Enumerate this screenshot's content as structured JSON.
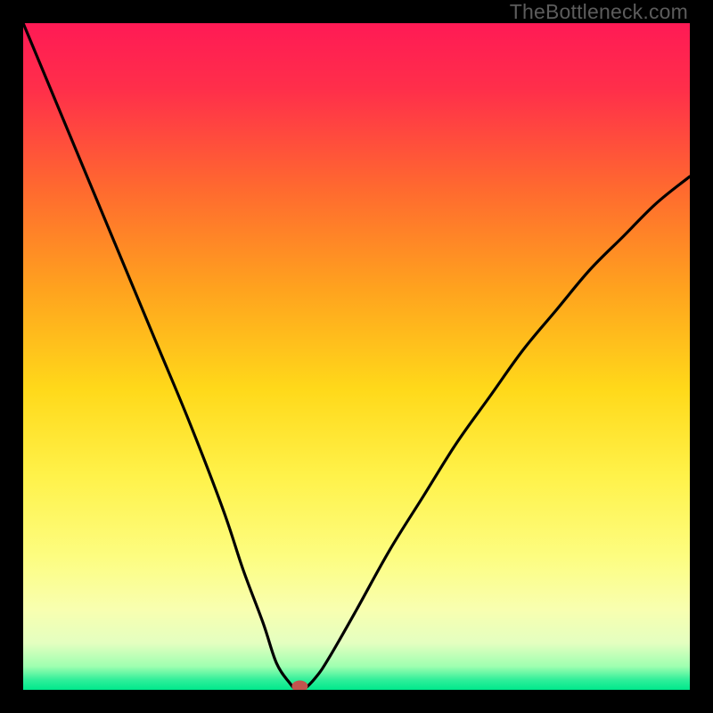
{
  "watermark": "TheBottleneck.com",
  "chart_data": {
    "type": "line",
    "title": "",
    "xlabel": "",
    "ylabel": "",
    "xlim": [
      0,
      100
    ],
    "ylim": [
      0,
      100
    ],
    "grid": false,
    "series": [
      {
        "name": "curve",
        "x": [
          0,
          5,
          10,
          15,
          20,
          25,
          30,
          33,
          36,
          38,
          40,
          41,
          42,
          44,
          46,
          50,
          55,
          60,
          65,
          70,
          75,
          80,
          85,
          90,
          95,
          100
        ],
        "values": [
          100,
          88,
          76,
          64,
          52,
          40,
          27,
          18,
          10,
          4,
          1,
          0,
          0,
          2,
          5,
          12,
          21,
          29,
          37,
          44,
          51,
          57,
          63,
          68,
          73,
          77
        ]
      }
    ],
    "marker": {
      "x": 41.5,
      "y": 0
    },
    "background_gradient": {
      "stops": [
        {
          "offset": 0.0,
          "color": "#ff1a55"
        },
        {
          "offset": 0.1,
          "color": "#ff2f4a"
        },
        {
          "offset": 0.25,
          "color": "#ff6a2f"
        },
        {
          "offset": 0.4,
          "color": "#ffa31e"
        },
        {
          "offset": 0.55,
          "color": "#ffd91a"
        },
        {
          "offset": 0.68,
          "color": "#fff24a"
        },
        {
          "offset": 0.8,
          "color": "#fdfd80"
        },
        {
          "offset": 0.88,
          "color": "#f8ffb0"
        },
        {
          "offset": 0.93,
          "color": "#e4ffc0"
        },
        {
          "offset": 0.965,
          "color": "#9effb0"
        },
        {
          "offset": 0.985,
          "color": "#30ef9a"
        },
        {
          "offset": 1.0,
          "color": "#00e88c"
        }
      ]
    }
  }
}
